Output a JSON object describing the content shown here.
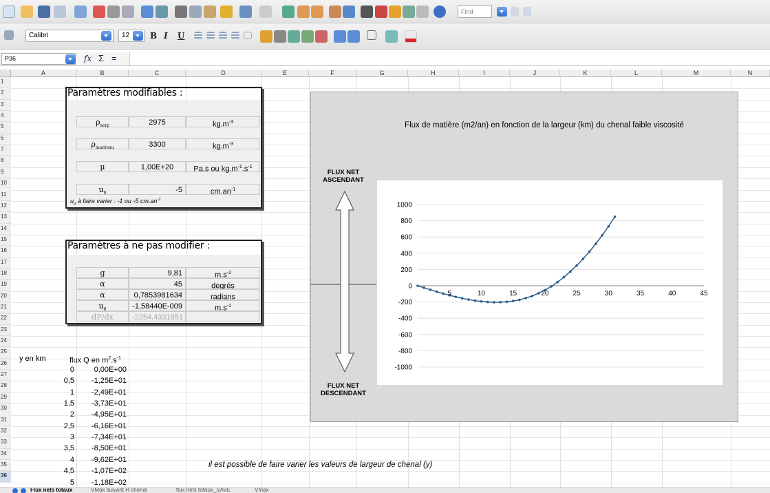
{
  "toolbar": {
    "find_placeholder": "Find",
    "font_name": "Calibri",
    "font_size": "12",
    "bold": "B",
    "italic": "I",
    "underline": "U"
  },
  "formula_bar": {
    "cell_ref": "P36",
    "fx": "fx",
    "sigma": "Σ",
    "equals": "="
  },
  "columns": [
    "A",
    "B",
    "C",
    "D",
    "E",
    "F",
    "G",
    "H",
    "I",
    "J",
    "K",
    "L",
    "M",
    "N"
  ],
  "rows": [
    "1",
    "2",
    "3",
    "4",
    "5",
    "6",
    "7",
    "8",
    "9",
    "10",
    "11",
    "12",
    "13",
    "14",
    "15",
    "16",
    "17",
    "18",
    "19",
    "20",
    "21",
    "22",
    "23",
    "24",
    "25",
    "26",
    "27",
    "28",
    "29",
    "30",
    "31",
    "32",
    "33",
    "34",
    "35",
    "36"
  ],
  "params_box": {
    "title": "Paramètres modifiables :",
    "rows": [
      {
        "symbol": "ρ",
        "sub": "serp",
        "value": "2975",
        "unit": "kg.m",
        "sup": "-3"
      },
      {
        "symbol": "ρ",
        "sub": "manteau",
        "value": "3300",
        "unit": "kg.m",
        "sup": "-3"
      },
      {
        "symbol": "μ",
        "sub": "",
        "value": "1,00E+20",
        "unit": "Pa.s ou kg.m",
        "sup": "-1",
        "unit2": ".s",
        "sup2": "-1"
      },
      {
        "symbol": "u",
        "sub": "0",
        "value": "-5",
        "unit": "cm.an",
        "sup": "-1"
      }
    ],
    "note": "u",
    "note_sub": "0",
    "note_rest": " à faire varier : -1 ou -5 cm.an",
    "note_sup": "-1"
  },
  "fixed_box": {
    "title": "Paramètres à ne pas modifier :",
    "rows": [
      {
        "symbol": "g",
        "sub": "",
        "value": "9,81",
        "unit": "m.s",
        "sup": "-2"
      },
      {
        "symbol": "α",
        "sub": "",
        "value": "45",
        "unit": "degrés",
        "sup": ""
      },
      {
        "symbol": "α",
        "sub": "",
        "value": "0,7853981634",
        "unit": "radians",
        "sup": ""
      },
      {
        "symbol": "u",
        "sub": "0",
        "value": "-1,58440E-009",
        "unit": "m.s",
        "sup": "-1"
      },
      {
        "symbol": "dP/dx",
        "sub": "",
        "value": "-2254,4331951",
        "unit": "",
        "sup": ""
      }
    ]
  },
  "data_table": {
    "header_y": "y en km",
    "header_q": "flux Q en m",
    "header_q_sup": "2",
    "header_q_rest": ".s",
    "header_q_sup2": "-1",
    "rows": [
      {
        "y": "0",
        "q": "0,00E+00"
      },
      {
        "y": "0,5",
        "q": "-1,25E+01"
      },
      {
        "y": "1",
        "q": "-2,49E+01"
      },
      {
        "y": "1,5",
        "q": "-3,73E+01"
      },
      {
        "y": "2",
        "q": "-4,95E+01"
      },
      {
        "y": "2,5",
        "q": "-6,16E+01"
      },
      {
        "y": "3",
        "q": "-7,34E+01"
      },
      {
        "y": "3,5",
        "q": "-8,50E+01"
      },
      {
        "y": "4",
        "q": "-9,62E+01"
      },
      {
        "y": "4,5",
        "q": "-1,07E+02"
      },
      {
        "y": "5",
        "q": "-1,18E+02"
      }
    ]
  },
  "note_text": "il est possible de faire varier les valeurs de largeur de chenal (y)",
  "arrow_labels": {
    "up_line1": "FLUX NET",
    "up_line2": "ASCENDANT",
    "down_line1": "FLUX NET",
    "down_line2": "DESCENDANT"
  },
  "chart_data": {
    "type": "scatter",
    "title": "Flux de matière (m2/an) en fonction de la largeur (km)  du chenal faible viscosité",
    "xlabel": "",
    "ylabel": "",
    "xlim": [
      0,
      45
    ],
    "ylim": [
      -1000,
      1000
    ],
    "x_ticks": [
      5,
      10,
      15,
      20,
      25,
      30,
      35,
      40,
      45
    ],
    "y_ticks": [
      1000,
      800,
      600,
      400,
      200,
      0,
      -200,
      -400,
      -600,
      -800,
      -1000
    ],
    "grid": true,
    "color": "#2b5b8a",
    "series": [
      {
        "x": [
          0,
          1,
          2,
          3,
          4,
          5,
          6,
          7,
          8,
          9,
          10,
          11,
          12,
          13,
          14,
          15,
          16,
          17,
          18,
          19,
          20,
          21,
          22,
          23,
          24,
          25,
          26,
          27,
          28,
          29,
          30,
          31
        ],
        "y": [
          0,
          -24.9,
          -49.5,
          -73.4,
          -96.2,
          -118,
          -137,
          -155,
          -170,
          -183,
          -193,
          -200,
          -203,
          -202,
          -197,
          -188,
          -173,
          -152,
          -126,
          -93,
          -54,
          -8,
          46,
          106,
          174,
          249,
          331,
          420,
          516,
          620,
          731,
          850
        ]
      }
    ]
  },
  "tabs": [
    "Flux nets totaux",
    "VMax suivant H chenal",
    "flux nets totaux_SAVE",
    "Vmax"
  ]
}
